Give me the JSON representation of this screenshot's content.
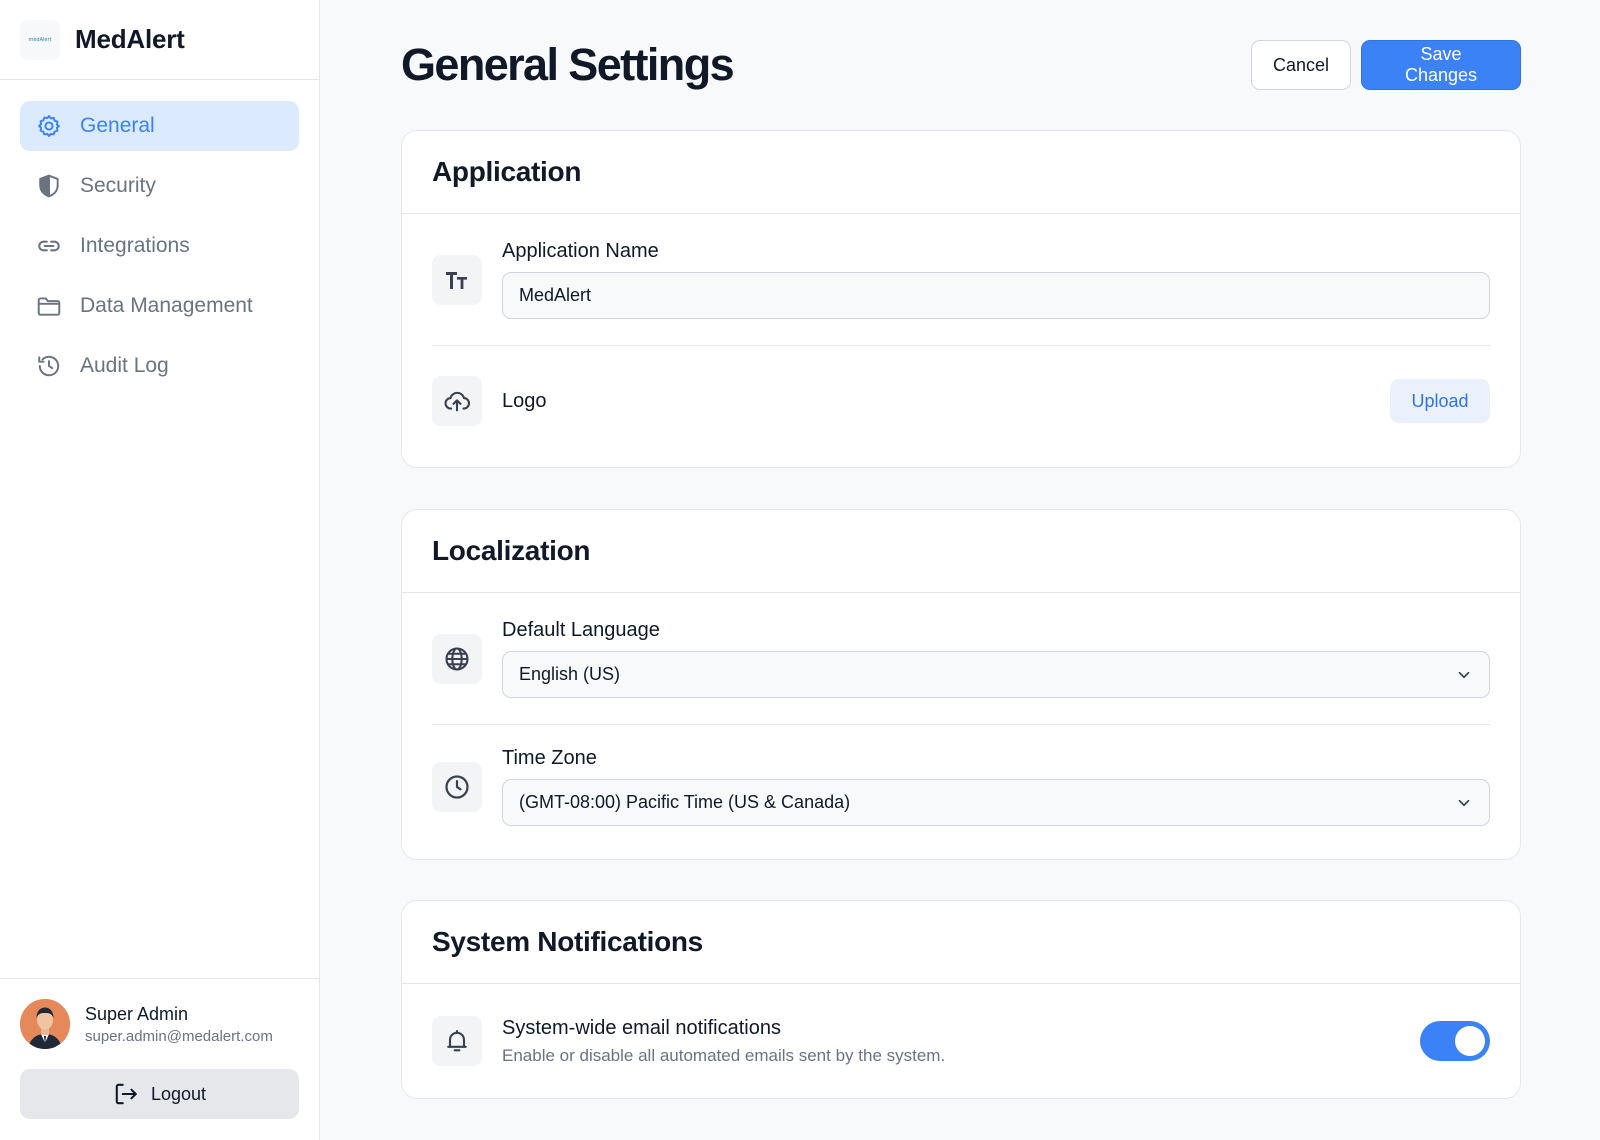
{
  "app": {
    "name": "MedAlert",
    "logo_text": "medAlert"
  },
  "sidebar": {
    "items": [
      {
        "label": "General",
        "icon": "gear-icon",
        "active": true
      },
      {
        "label": "Security",
        "icon": "shield-icon",
        "active": false
      },
      {
        "label": "Integrations",
        "icon": "link-icon",
        "active": false
      },
      {
        "label": "Data Management",
        "icon": "folder-icon",
        "active": false
      },
      {
        "label": "Audit Log",
        "icon": "history-icon",
        "active": false
      }
    ],
    "user": {
      "name": "Super Admin",
      "email": "super.admin@medalert.com"
    },
    "logout_label": "Logout"
  },
  "header": {
    "title": "General Settings",
    "cancel_label": "Cancel",
    "save_label": "Save Changes"
  },
  "sections": {
    "application": {
      "title": "Application",
      "app_name_label": "Application Name",
      "app_name_value": "MedAlert",
      "logo_label": "Logo",
      "upload_label": "Upload"
    },
    "localization": {
      "title": "Localization",
      "language_label": "Default Language",
      "language_value": "English (US)",
      "timezone_label": "Time Zone",
      "timezone_value": "(GMT-08:00) Pacific Time (US & Canada)"
    },
    "notifications": {
      "title": "System Notifications",
      "email_label": "System-wide email notifications",
      "email_desc": "Enable or disable all automated emails sent by the system.",
      "email_enabled": true
    }
  },
  "colors": {
    "accent": "#3b82f6",
    "active_bg": "#dbeafe",
    "muted_text": "#6b7280"
  }
}
